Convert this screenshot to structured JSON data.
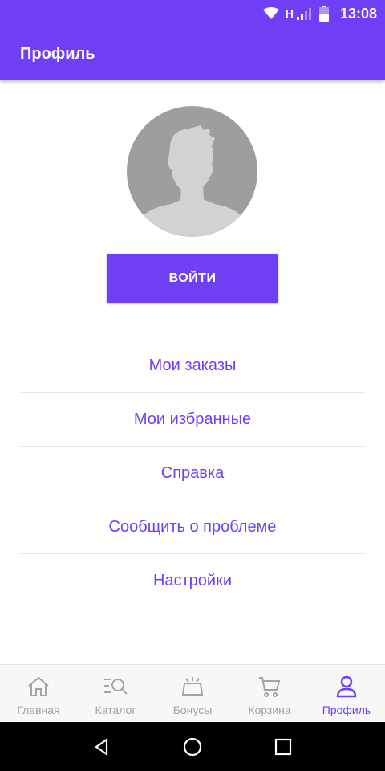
{
  "status_bar": {
    "network_type": "H",
    "time": "13:08",
    "icons": [
      "wifi-icon",
      "signal-icon",
      "battery-icon"
    ]
  },
  "app_bar": {
    "title": "Профиль"
  },
  "profile": {
    "avatar_icon": "avatar-placeholder-icon",
    "login_label": "ВОЙТИ"
  },
  "menu": {
    "items": [
      {
        "label": "Мои заказы"
      },
      {
        "label": "Мои избранные"
      },
      {
        "label": "Справка"
      },
      {
        "label": "Сообщить о проблеме"
      },
      {
        "label": "Настройки"
      }
    ]
  },
  "bottom_nav": {
    "items": [
      {
        "label": "Главная",
        "icon": "home-icon",
        "active": false
      },
      {
        "label": "Каталог",
        "icon": "catalog-search-icon",
        "active": false
      },
      {
        "label": "Бонусы",
        "icon": "bonus-tv-icon",
        "active": false
      },
      {
        "label": "Корзина",
        "icon": "cart-icon",
        "active": false
      },
      {
        "label": "Профиль",
        "icon": "profile-icon",
        "active": true
      }
    ]
  },
  "system_nav": {
    "icons": [
      "back-icon",
      "home-circle-icon",
      "recents-icon"
    ]
  },
  "colors": {
    "accent": "#6f3ff5",
    "inactive": "#a3a3a3",
    "avatar_bg": "#9e9e9e",
    "divider": "#e6e6e6"
  }
}
